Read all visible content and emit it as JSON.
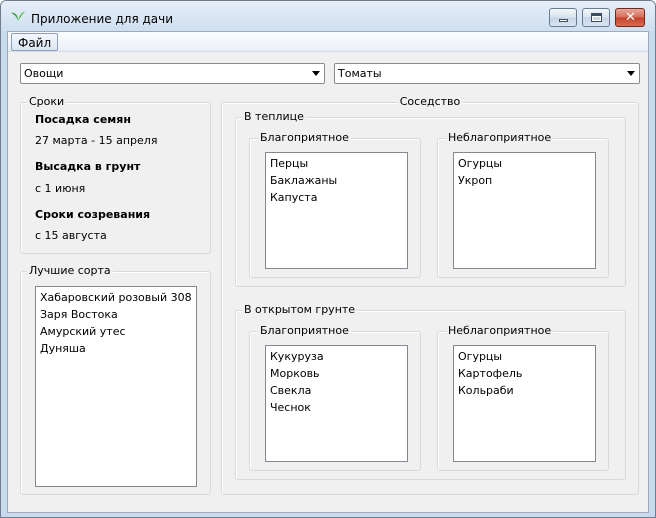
{
  "window": {
    "title": "Приложение для дачи"
  },
  "menu": {
    "file": "Файл"
  },
  "selectors": {
    "category": "Овощи",
    "crop": "Томаты"
  },
  "terms": {
    "title": "Сроки",
    "sowing_label": "Посадка семян",
    "sowing_value": "27 марта - 15 апреля",
    "planting_label": "Высадка в грунт",
    "planting_value": "с 1 июня",
    "ripening_label": "Сроки созревания",
    "ripening_value": "с 15 августа"
  },
  "best_varieties": {
    "title": "Лучшие сорта",
    "items": [
      "Хабаровский розовый 308",
      "Заря Востока",
      "Амурский утес",
      "Дуняша"
    ]
  },
  "neighborhood": {
    "title": "Соседство",
    "greenhouse": {
      "title": "В теплице",
      "good_title": "Благоприятное",
      "good": [
        "Перцы",
        "Баклажаны",
        "Капуста"
      ],
      "bad_title": "Неблагоприятное",
      "bad": [
        "Огурцы",
        "Укроп"
      ]
    },
    "open_ground": {
      "title": "В открытом грунте",
      "good_title": "Благоприятное",
      "good": [
        "Кукуруза",
        "Морковь",
        "Свекла",
        "Чеснок"
      ],
      "bad_title": "Неблагоприятное",
      "bad": [
        "Огурцы",
        "Картофель",
        "Кольраби"
      ]
    }
  },
  "colors": {
    "accent": "#3a9a3a",
    "window_frame": "#cfdff0",
    "client_bg": "#f0f0f0"
  }
}
